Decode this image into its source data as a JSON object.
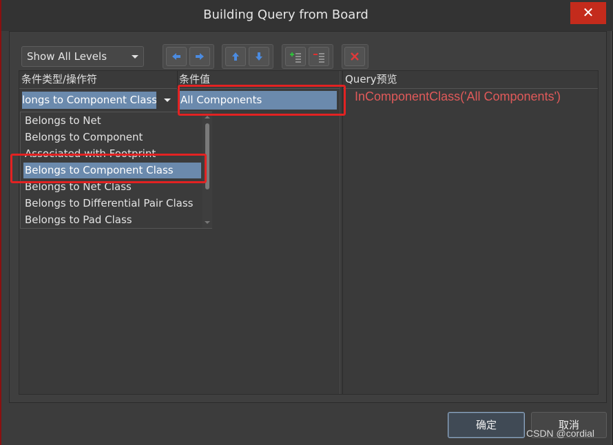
{
  "window": {
    "title": "Building Query from Board",
    "close_glyph": "✕"
  },
  "toolbar": {
    "level_select": "Show All Levels",
    "icons": [
      "move-left-icon",
      "move-right-icon",
      "move-up-icon",
      "move-down-icon",
      "add-row-icon",
      "remove-row-icon",
      "clear-icon"
    ]
  },
  "grid": {
    "headers": {
      "condition_type": "条件类型/操作符",
      "condition_value": "条件值",
      "query_preview": "Query预览"
    },
    "row": {
      "condition_type": "longs to Component Class",
      "condition_value": "All Components"
    },
    "preview_text": "InComponentClass('All Components')"
  },
  "dropdown": {
    "items": [
      "Belongs to Net",
      "Belongs to Component",
      "Associated with Footprint",
      "Belongs to Component Class",
      "Belongs to Net Class",
      "Belongs to Differential Pair Class",
      "Belongs to Pad Class"
    ],
    "selected_index": 3
  },
  "buttons": {
    "ok": "确定",
    "cancel": "取消"
  },
  "watermark": "CSDN @cordial",
  "colors": {
    "highlight": "#6b8aad",
    "annotation_red": "#e32222",
    "preview_red": "#e05a5a"
  }
}
